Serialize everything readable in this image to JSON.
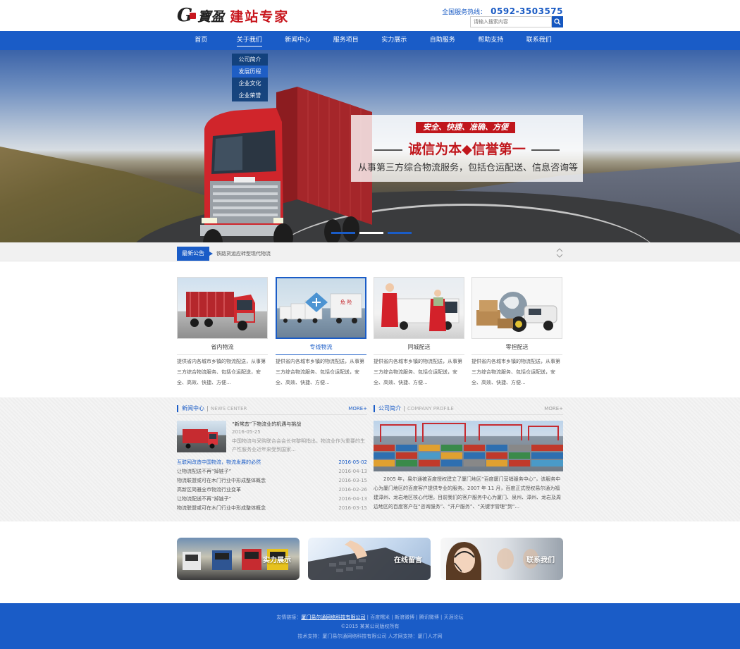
{
  "header": {
    "logo_g": "G",
    "logo_cal": "寶盈",
    "logo_text": "建站专家",
    "hotline_label": "全国服务热线：",
    "hotline_number": "0592-3503575",
    "search_placeholder": "请输入搜索内容"
  },
  "nav": {
    "items": [
      "首页",
      "关于我们",
      "新闻中心",
      "服务项目",
      "实力展示",
      "自助服务",
      "帮助支持",
      "联系我们"
    ],
    "active_index": 1,
    "dropdown": [
      "公司简介",
      "发展历程",
      "企业文化",
      "企业荣誉"
    ]
  },
  "banner": {
    "tag": "安全、快捷、准确、方便",
    "title": "诚信为本◆信誉第一",
    "subtitle": "从事第三方综合物流服务，包括仓运配送、信息咨询等"
  },
  "notice": {
    "tag": "最新公告",
    "text": "铁路货运应转型现代物流"
  },
  "services": [
    {
      "name": "省内物流",
      "desc": "提供省内各城市乡镇的物流配送，从事第三方综合物流服务、包括仓运配送，安全、高效、快捷、方便..."
    },
    {
      "name": "专线物流",
      "desc": "提供省内各城市乡镇的物流配送，从事第三方综合物流服务、包括仓运配送，安全、高效、快捷、方便..."
    },
    {
      "name": "同城配送",
      "desc": "提供省内各城市乡镇的物流配送，从事第三方综合物流服务、包括仓运配送，安全、高效、快捷、方便..."
    },
    {
      "name": "零担配送",
      "desc": "提供省内各城市乡镇的物流配送，从事第三方综合物流服务、包括仓运配送，安全、高效、快捷、方便..."
    }
  ],
  "news": {
    "title": "新闻中心",
    "title_en": "NEWS CENTER",
    "more": "MORE+",
    "top": {
      "title": "“新常态”下物流业的机遇与挑战",
      "date": "2016-05-25",
      "summary": "中国物流与采购联合会会长何黎明指出，物流业作为重要的生产性服务业近年来受到国家..."
    },
    "list": [
      {
        "title": "互联网改造中国物流，物流发展的必然",
        "date": "2016-05-02"
      },
      {
        "title": "让物流配送不再“掉链子”",
        "date": "2016-04-13"
      },
      {
        "title": "物流联盟或可在木门行业中形成整体概念",
        "date": "2016-03-15"
      },
      {
        "title": "高新区简雅全市物流行业变革",
        "date": "2016-02-26"
      },
      {
        "title": "让物流配送不再“掉链子”",
        "date": "2016-04-13"
      },
      {
        "title": "物流联盟或可在木门行业中形成整体概念",
        "date": "2016-03-15"
      }
    ]
  },
  "company": {
    "title": "公司简介",
    "title_en": "COMPANY PROFILE",
    "more": "MORE+",
    "text": "2005 年，易尔通被百度授权建立了厦门地区“百度厦门营销服务中心”，该服务中心为厦门地区的百度客户提供专业的服务。2007 年 11 月，百度正式授权易尔通为福建漳州、龙岩地区核心代理。目前我们的客户服务中心为厦门、泉州、漳州、龙岩及周边地区的百度客户在“咨询服务”、“开户服务”、“关键字管理”到“..."
  },
  "features": [
    {
      "label": "实力展示"
    },
    {
      "label": "在线留言"
    },
    {
      "label": "联系我们"
    }
  ],
  "footer": {
    "links_label": "友情链接：",
    "links": [
      "厦门易尔通网络科技有限公司",
      "百度糯米",
      "新浪微博",
      "腾讯微博",
      "天涯论坛"
    ],
    "copyright": "©2015  某某公司版权所有",
    "support": "技术支持：厦门易尔通网络科技有限公司    人才网支持：厦门人才网"
  },
  "colors": {
    "brand_blue": "#1a5cc7",
    "accent_red": "#c0161c"
  }
}
